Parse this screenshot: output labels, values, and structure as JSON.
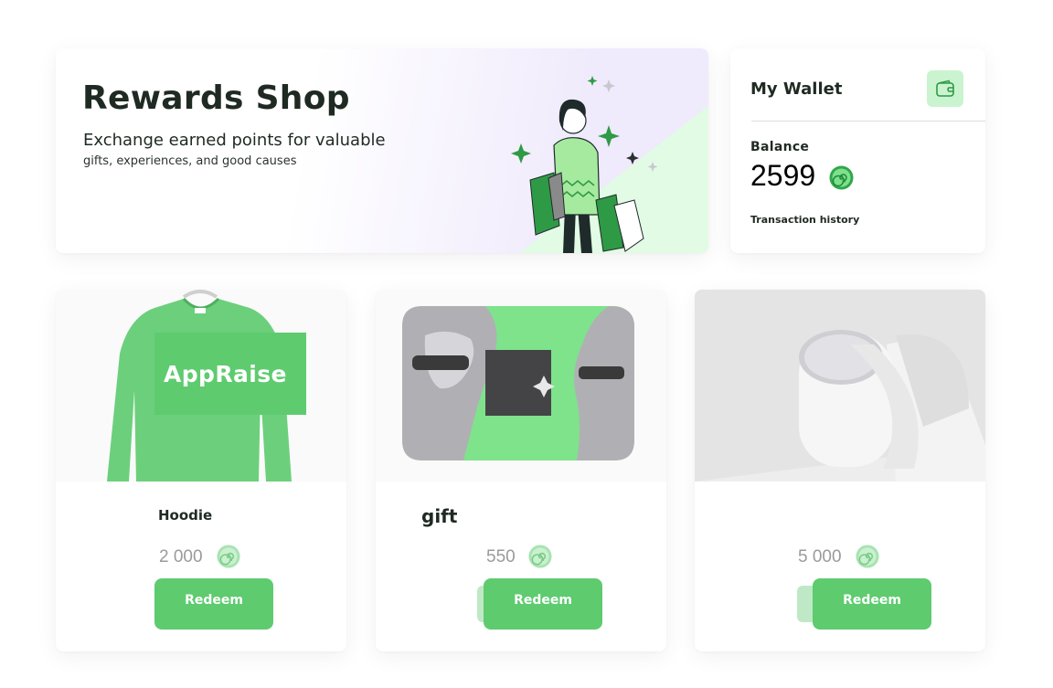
{
  "hero": {
    "title": "Rewards Shop",
    "subtitle_line1": "Exchange earned points for valuable",
    "subtitle_line2": "gifts, experiences, and good causes",
    "illustration": "shopping-woman-illustration"
  },
  "wallet": {
    "title": "My Wallet",
    "icon": "wallet-icon",
    "balance_label": "Balance",
    "balance_value": "2599",
    "currency_icon": "coin-icon",
    "transaction_history_label": "Transaction history"
  },
  "products": [
    {
      "name": "Hoodie",
      "image": "green-sweatshirt",
      "image_overlay_text": "AppRaise",
      "price": "2 000",
      "currency_icon": "coin-icon",
      "redeem_label": "Redeem"
    },
    {
      "name": "gift",
      "image": "statue-busts-with-sunglasses",
      "price": "550",
      "currency_icon": "coin-icon",
      "redeem_label": "Redeem"
    },
    {
      "name": "",
      "image": "white-speaker",
      "price": "5 000",
      "currency_icon": "coin-icon",
      "redeem_label": "Redeem"
    }
  ],
  "colors": {
    "accent_green": "#5ecb6f",
    "accent_green_light": "#c9f4cf",
    "text_dark": "#1f2a22",
    "price_gray": "#9a9a9a"
  }
}
